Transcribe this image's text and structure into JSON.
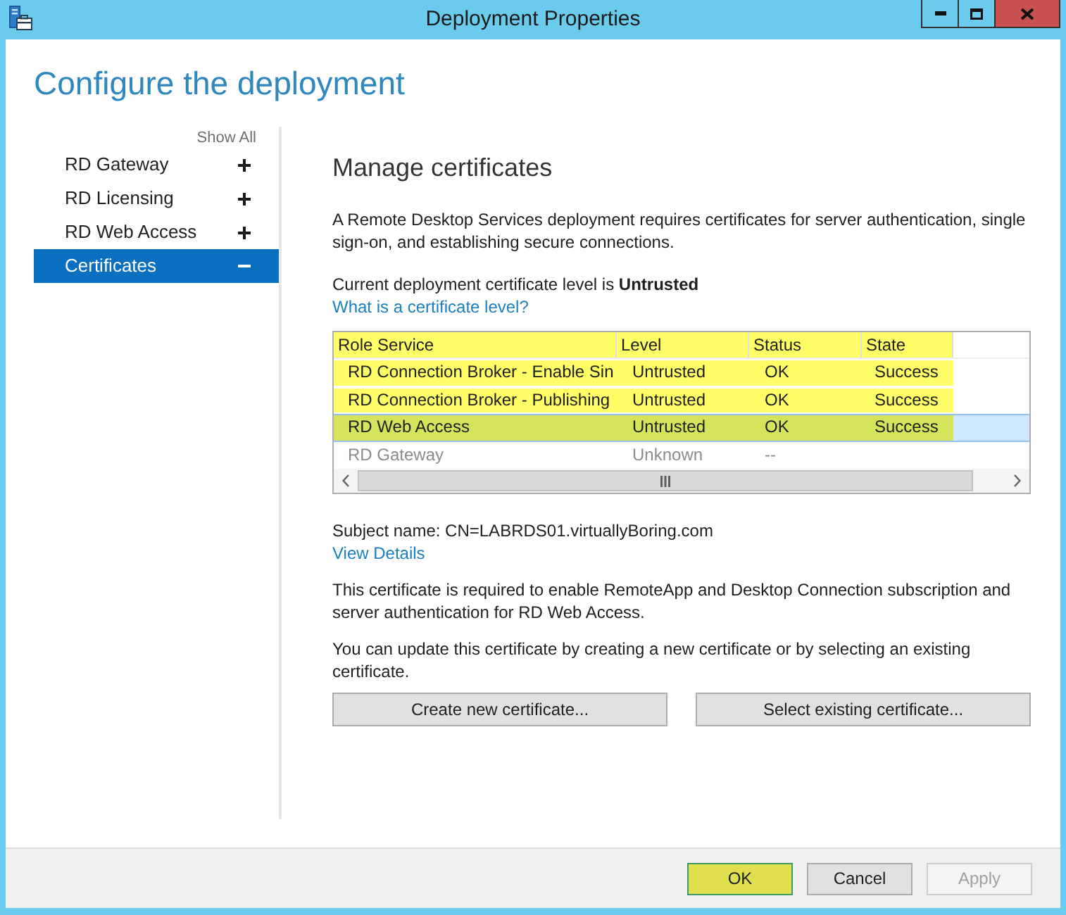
{
  "window": {
    "title": "Deployment Properties"
  },
  "heading": "Configure the deployment",
  "sidebar": {
    "show_all": "Show All",
    "items": [
      {
        "label": "RD Gateway",
        "expanded": false,
        "selected": false
      },
      {
        "label": "RD Licensing",
        "expanded": false,
        "selected": false
      },
      {
        "label": "RD Web Access",
        "expanded": false,
        "selected": false
      },
      {
        "label": "Certificates",
        "expanded": true,
        "selected": true
      }
    ]
  },
  "panel": {
    "title": "Manage certificates",
    "description": "A Remote Desktop Services deployment requires certificates for server authentication, single sign-on, and establishing secure connections.",
    "level_text": "Current deployment certificate level is **Untrusted**",
    "level_link": "What is a certificate level?",
    "table": {
      "header_highlighted": true,
      "columns": [
        "Role Service",
        "Level",
        "Status",
        "State"
      ],
      "rows": [
        {
          "cells": [
            "RD Connection Broker - Enable Sin",
            "Untrusted",
            "OK",
            "Success"
          ],
          "highlighted": true,
          "selected": false,
          "disabled": false
        },
        {
          "cells": [
            "RD Connection Broker - Publishing",
            "Untrusted",
            "OK",
            "Success"
          ],
          "highlighted": true,
          "selected": false,
          "disabled": false
        },
        {
          "cells": [
            "RD Web Access",
            "Untrusted",
            "OK",
            "Success"
          ],
          "highlighted": true,
          "selected": true,
          "disabled": false
        },
        {
          "cells": [
            "RD Gateway",
            "Unknown",
            "--"
          ],
          "highlighted": false,
          "selected": false,
          "disabled": true
        }
      ]
    },
    "subject": "Subject name: CN=LABRDS01.virtuallyBoring.com",
    "details_link": "View Details",
    "note": "This certificate is required to enable RemoteApp and Desktop Connection subscription and server authentication for RD Web Access.",
    "update_note": "You can update this certificate by creating a new certificate or by selecting an existing certificate.",
    "actions": [
      "Create new certificate...",
      "Select existing certificate..."
    ]
  },
  "footer": {
    "buttons": [
      {
        "label": "OK",
        "highlighted": true,
        "disabled": false
      },
      {
        "label": "Cancel",
        "highlighted": false,
        "disabled": false
      },
      {
        "label": "Apply",
        "highlighted": false,
        "disabled": true
      }
    ]
  }
}
